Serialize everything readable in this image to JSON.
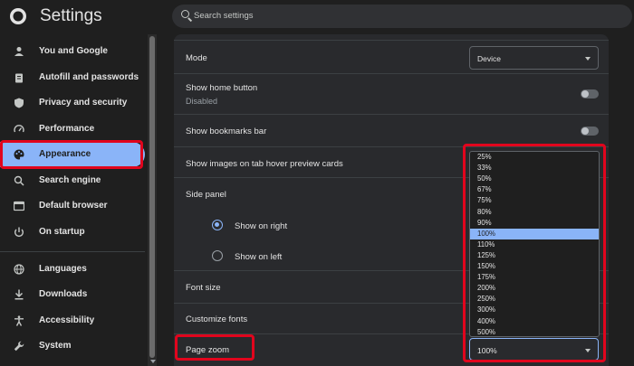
{
  "app": {
    "title": "Settings"
  },
  "search": {
    "placeholder": "Search settings"
  },
  "sidebar": {
    "items": [
      {
        "label": "You and Google",
        "icon": "person-icon"
      },
      {
        "label": "Autofill and passwords",
        "icon": "clipboard-icon"
      },
      {
        "label": "Privacy and security",
        "icon": "shield-icon"
      },
      {
        "label": "Performance",
        "icon": "gauge-icon"
      },
      {
        "label": "Appearance",
        "icon": "palette-icon",
        "active": true
      },
      {
        "label": "Search engine",
        "icon": "search-icon"
      },
      {
        "label": "Default browser",
        "icon": "browser-icon"
      },
      {
        "label": "On startup",
        "icon": "power-icon"
      },
      {
        "label": "Languages",
        "icon": "globe-icon"
      },
      {
        "label": "Downloads",
        "icon": "download-icon"
      },
      {
        "label": "Accessibility",
        "icon": "accessibility-icon"
      },
      {
        "label": "System",
        "icon": "wrench-icon"
      }
    ]
  },
  "appearance": {
    "mode": {
      "label": "Mode",
      "value": "Device"
    },
    "home_button": {
      "label": "Show home button",
      "status": "Disabled",
      "enabled": false
    },
    "bookmarks_bar": {
      "label": "Show bookmarks bar",
      "enabled": false
    },
    "hover_cards": {
      "label": "Show images on tab hover preview cards"
    },
    "side_panel": {
      "label": "Side panel",
      "options": [
        "Show on right",
        "Show on left"
      ],
      "selected": "Show on right"
    },
    "font_size": {
      "label": "Font size"
    },
    "customize_fonts": {
      "label": "Customize fonts"
    },
    "page_zoom": {
      "label": "Page zoom",
      "value": "100%"
    }
  },
  "zoom_options": [
    "25%",
    "33%",
    "50%",
    "67%",
    "75%",
    "80%",
    "90%",
    "100%",
    "110%",
    "125%",
    "150%",
    "175%",
    "200%",
    "250%",
    "300%",
    "400%",
    "500%"
  ],
  "zoom_selected": "100%",
  "colors": {
    "accent": "#8ab4f8",
    "highlight_box": "#e1051d",
    "background": "#1f1f1f",
    "card": "#292a2d"
  }
}
